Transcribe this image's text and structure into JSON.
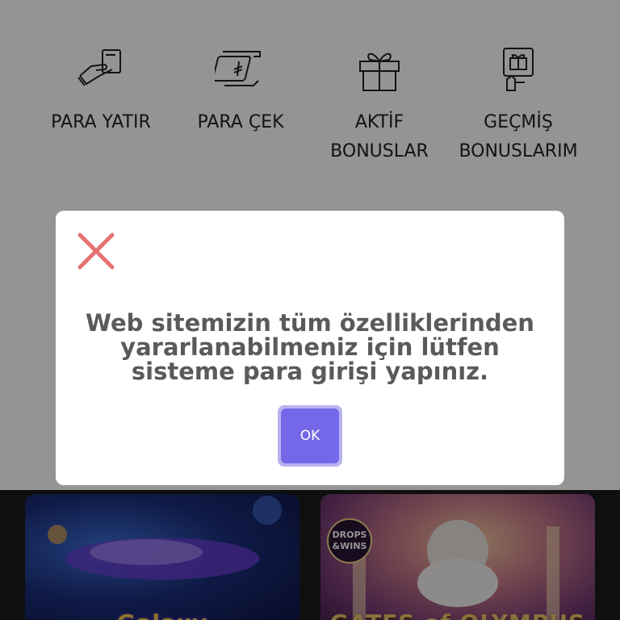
{
  "quick_actions": [
    {
      "icon": "hand-card-icon",
      "label_lines": [
        "PARA YATIR"
      ]
    },
    {
      "icon": "lira-banknote-icon",
      "label_lines": [
        "PARA ÇEK"
      ]
    },
    {
      "icon": "gift-icon",
      "label_lines": [
        "AKTİF",
        "BONUSLAR"
      ]
    },
    {
      "icon": "gift-history-icon",
      "label_lines": [
        "GEÇMİŞ",
        "BONUSLARIM"
      ]
    }
  ],
  "modal": {
    "close_icon": "close-icon",
    "close_color": "#e57373",
    "message_lines": [
      "Web sitemizin tüm özelliklerinden",
      "yararlanabilmeniz için lütfen",
      "sisteme para girişi yapınız."
    ],
    "ok_label": "OK",
    "ok_color": "#7468e8"
  },
  "games": [
    {
      "title": "Galaxy"
    },
    {
      "badge_lines": [
        "DROPS",
        "&WINS"
      ],
      "title": "GATES of OLYMPUS"
    }
  ]
}
